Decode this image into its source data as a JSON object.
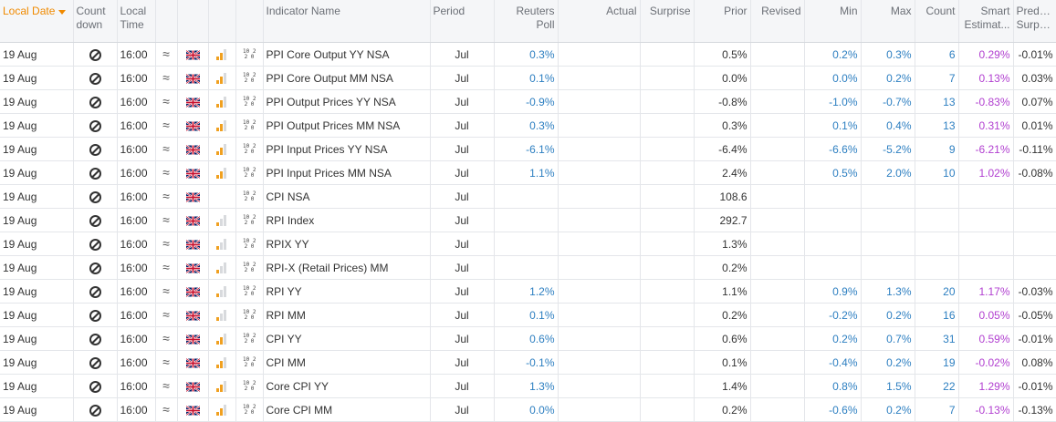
{
  "headers": {
    "local_date": "Local Date",
    "countdown": "Count down",
    "local_time": "Local Time",
    "indicator": "Indicator Name",
    "period": "Period",
    "poll": "Reuters Poll",
    "actual": "Actual",
    "surprise": "Surprise",
    "prior": "Prior",
    "revised": "Revised",
    "min": "Min",
    "max": "Max",
    "count": "Count",
    "smart": "Smart Estimat...",
    "predict": "Predict... Surprise"
  },
  "colors": {
    "sort_accent": "#f08a00",
    "poll_value": "#2d7fc1",
    "smart_estimate": "#b13fd0"
  },
  "rows": [
    {
      "date": "19 Aug",
      "time": "16:00",
      "importance": "high",
      "name": "PPI Core Output YY NSA",
      "period": "Jul",
      "poll": "0.3%",
      "actual": "",
      "surprise": "",
      "prior": "0.5%",
      "revised": "",
      "min": "0.2%",
      "max": "0.3%",
      "count": "6",
      "smart": "0.29%",
      "predict": "-0.01%"
    },
    {
      "date": "19 Aug",
      "time": "16:00",
      "importance": "high",
      "name": "PPI Core Output MM NSA",
      "period": "Jul",
      "poll": "0.1%",
      "actual": "",
      "surprise": "",
      "prior": "0.0%",
      "revised": "",
      "min": "0.0%",
      "max": "0.2%",
      "count": "7",
      "smart": "0.13%",
      "predict": "0.03%"
    },
    {
      "date": "19 Aug",
      "time": "16:00",
      "importance": "high",
      "name": "PPI Output Prices YY NSA",
      "period": "Jul",
      "poll": "-0.9%",
      "actual": "",
      "surprise": "",
      "prior": "-0.8%",
      "revised": "",
      "min": "-1.0%",
      "max": "-0.7%",
      "count": "13",
      "smart": "-0.83%",
      "predict": "0.07%"
    },
    {
      "date": "19 Aug",
      "time": "16:00",
      "importance": "high",
      "name": "PPI Output Prices MM NSA",
      "period": "Jul",
      "poll": "0.3%",
      "actual": "",
      "surprise": "",
      "prior": "0.3%",
      "revised": "",
      "min": "0.1%",
      "max": "0.4%",
      "count": "13",
      "smart": "0.31%",
      "predict": "0.01%"
    },
    {
      "date": "19 Aug",
      "time": "16:00",
      "importance": "high",
      "name": "PPI Input Prices YY NSA",
      "period": "Jul",
      "poll": "-6.1%",
      "actual": "",
      "surprise": "",
      "prior": "-6.4%",
      "revised": "",
      "min": "-6.6%",
      "max": "-5.2%",
      "count": "9",
      "smart": "-6.21%",
      "predict": "-0.11%"
    },
    {
      "date": "19 Aug",
      "time": "16:00",
      "importance": "high",
      "name": "PPI Input Prices MM NSA",
      "period": "Jul",
      "poll": "1.1%",
      "actual": "",
      "surprise": "",
      "prior": "2.4%",
      "revised": "",
      "min": "0.5%",
      "max": "2.0%",
      "count": "10",
      "smart": "1.02%",
      "predict": "-0.08%"
    },
    {
      "date": "19 Aug",
      "time": "16:00",
      "importance": "none",
      "name": "CPI NSA",
      "period": "Jul",
      "poll": "",
      "actual": "",
      "surprise": "",
      "prior": "108.6",
      "revised": "",
      "min": "",
      "max": "",
      "count": "",
      "smart": "",
      "predict": ""
    },
    {
      "date": "19 Aug",
      "time": "16:00",
      "importance": "low",
      "name": "RPI Index",
      "period": "Jul",
      "poll": "",
      "actual": "",
      "surprise": "",
      "prior": "292.7",
      "revised": "",
      "min": "",
      "max": "",
      "count": "",
      "smart": "",
      "predict": ""
    },
    {
      "date": "19 Aug",
      "time": "16:00",
      "importance": "low",
      "name": "RPIX YY",
      "period": "Jul",
      "poll": "",
      "actual": "",
      "surprise": "",
      "prior": "1.3%",
      "revised": "",
      "min": "",
      "max": "",
      "count": "",
      "smart": "",
      "predict": ""
    },
    {
      "date": "19 Aug",
      "time": "16:00",
      "importance": "low",
      "name": "RPI-X (Retail Prices) MM",
      "period": "Jul",
      "poll": "",
      "actual": "",
      "surprise": "",
      "prior": "0.2%",
      "revised": "",
      "min": "",
      "max": "",
      "count": "",
      "smart": "",
      "predict": ""
    },
    {
      "date": "19 Aug",
      "time": "16:00",
      "importance": "low",
      "name": "RPI YY",
      "period": "Jul",
      "poll": "1.2%",
      "actual": "",
      "surprise": "",
      "prior": "1.1%",
      "revised": "",
      "min": "0.9%",
      "max": "1.3%",
      "count": "20",
      "smart": "1.17%",
      "predict": "-0.03%"
    },
    {
      "date": "19 Aug",
      "time": "16:00",
      "importance": "low",
      "name": "RPI MM",
      "period": "Jul",
      "poll": "0.1%",
      "actual": "",
      "surprise": "",
      "prior": "0.2%",
      "revised": "",
      "min": "-0.2%",
      "max": "0.2%",
      "count": "16",
      "smart": "0.05%",
      "predict": "-0.05%"
    },
    {
      "date": "19 Aug",
      "time": "16:00",
      "importance": "high",
      "name": "CPI YY",
      "period": "Jul",
      "poll": "0.6%",
      "actual": "",
      "surprise": "",
      "prior": "0.6%",
      "revised": "",
      "min": "0.2%",
      "max": "0.7%",
      "count": "31",
      "smart": "0.59%",
      "predict": "-0.01%"
    },
    {
      "date": "19 Aug",
      "time": "16:00",
      "importance": "high",
      "name": "CPI MM",
      "period": "Jul",
      "poll": "-0.1%",
      "actual": "",
      "surprise": "",
      "prior": "0.1%",
      "revised": "",
      "min": "-0.4%",
      "max": "0.2%",
      "count": "19",
      "smart": "-0.02%",
      "predict": "0.08%"
    },
    {
      "date": "19 Aug",
      "time": "16:00",
      "importance": "high",
      "name": "Core CPI YY",
      "period": "Jul",
      "poll": "1.3%",
      "actual": "",
      "surprise": "",
      "prior": "1.4%",
      "revised": "",
      "min": "0.8%",
      "max": "1.5%",
      "count": "22",
      "smart": "1.29%",
      "predict": "-0.01%"
    },
    {
      "date": "19 Aug",
      "time": "16:00",
      "importance": "high",
      "name": "Core CPI MM",
      "period": "Jul",
      "poll": "0.0%",
      "actual": "",
      "surprise": "",
      "prior": "0.2%",
      "revised": "",
      "min": "-0.6%",
      "max": "0.2%",
      "count": "7",
      "smart": "-0.13%",
      "predict": "-0.13%"
    }
  ]
}
